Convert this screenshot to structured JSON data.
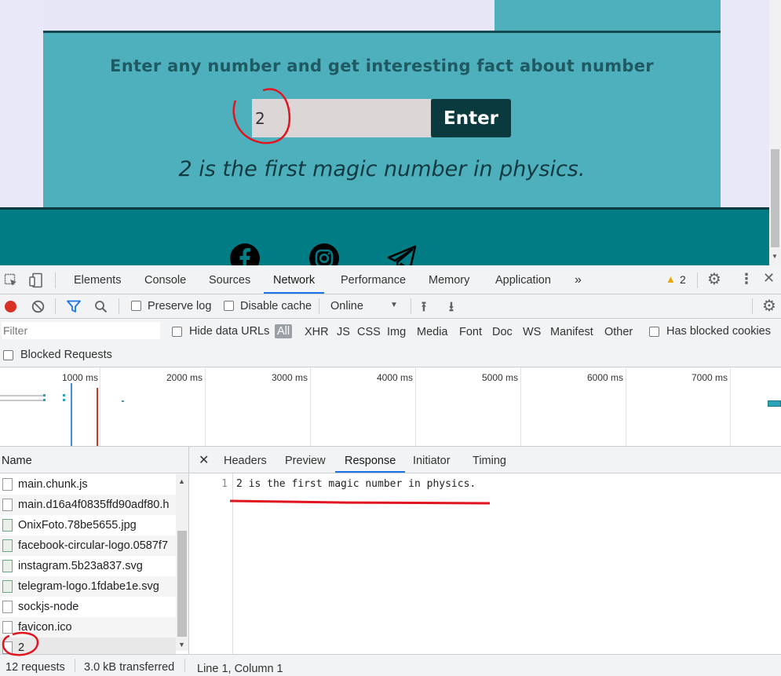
{
  "page": {
    "prompt": "Enter any number and get interesting fact about number",
    "input_value": "2",
    "enter_label": "Enter",
    "fact": "2 is the first magic number in physics.",
    "colors": {
      "section": "#4fb0bd",
      "footer": "#007c85",
      "button": "#0a3a3e"
    },
    "social_icons": [
      "facebook-icon",
      "instagram-icon",
      "telegram-icon"
    ]
  },
  "devtools": {
    "tabs": [
      "Elements",
      "Console",
      "Sources",
      "Network",
      "Performance",
      "Memory",
      "Application"
    ],
    "active_tab": "Network",
    "warning_count": "2",
    "toolbar": {
      "preserve_log": "Preserve log",
      "disable_cache": "Disable cache",
      "throttling": "Online"
    },
    "filter": {
      "placeholder": "Filter",
      "hide_data_urls": "Hide data URLs",
      "types": [
        "All",
        "XHR",
        "JS",
        "CSS",
        "Img",
        "Media",
        "Font",
        "Doc",
        "WS",
        "Manifest",
        "Other"
      ],
      "has_blocked_cookies": "Has blocked cookies",
      "blocked_requests": "Blocked Requests"
    },
    "overview_ticks": [
      "1000 ms",
      "2000 ms",
      "3000 ms",
      "4000 ms",
      "5000 ms",
      "6000 ms",
      "7000 ms"
    ],
    "names_header": "Name",
    "requests": [
      "main.chunk.js",
      "main.d16a4f0835ffd90adf80.h",
      "OnixFoto.78be5655.jpg",
      "facebook-circular-logo.0587f7",
      "instagram.5b23a837.svg",
      "telegram-logo.1fdabe1e.svg",
      "sockjs-node",
      "favicon.ico",
      "2"
    ],
    "detail_tabs": [
      "Headers",
      "Preview",
      "Response",
      "Initiator",
      "Timing"
    ],
    "active_detail_tab": "Response",
    "response": {
      "line_number": "1",
      "text": "2 is the first magic number in physics."
    },
    "status": {
      "requests": "12 requests",
      "transferred": "3.0 kB transferred",
      "cursor": "Line 1, Column 1"
    }
  }
}
